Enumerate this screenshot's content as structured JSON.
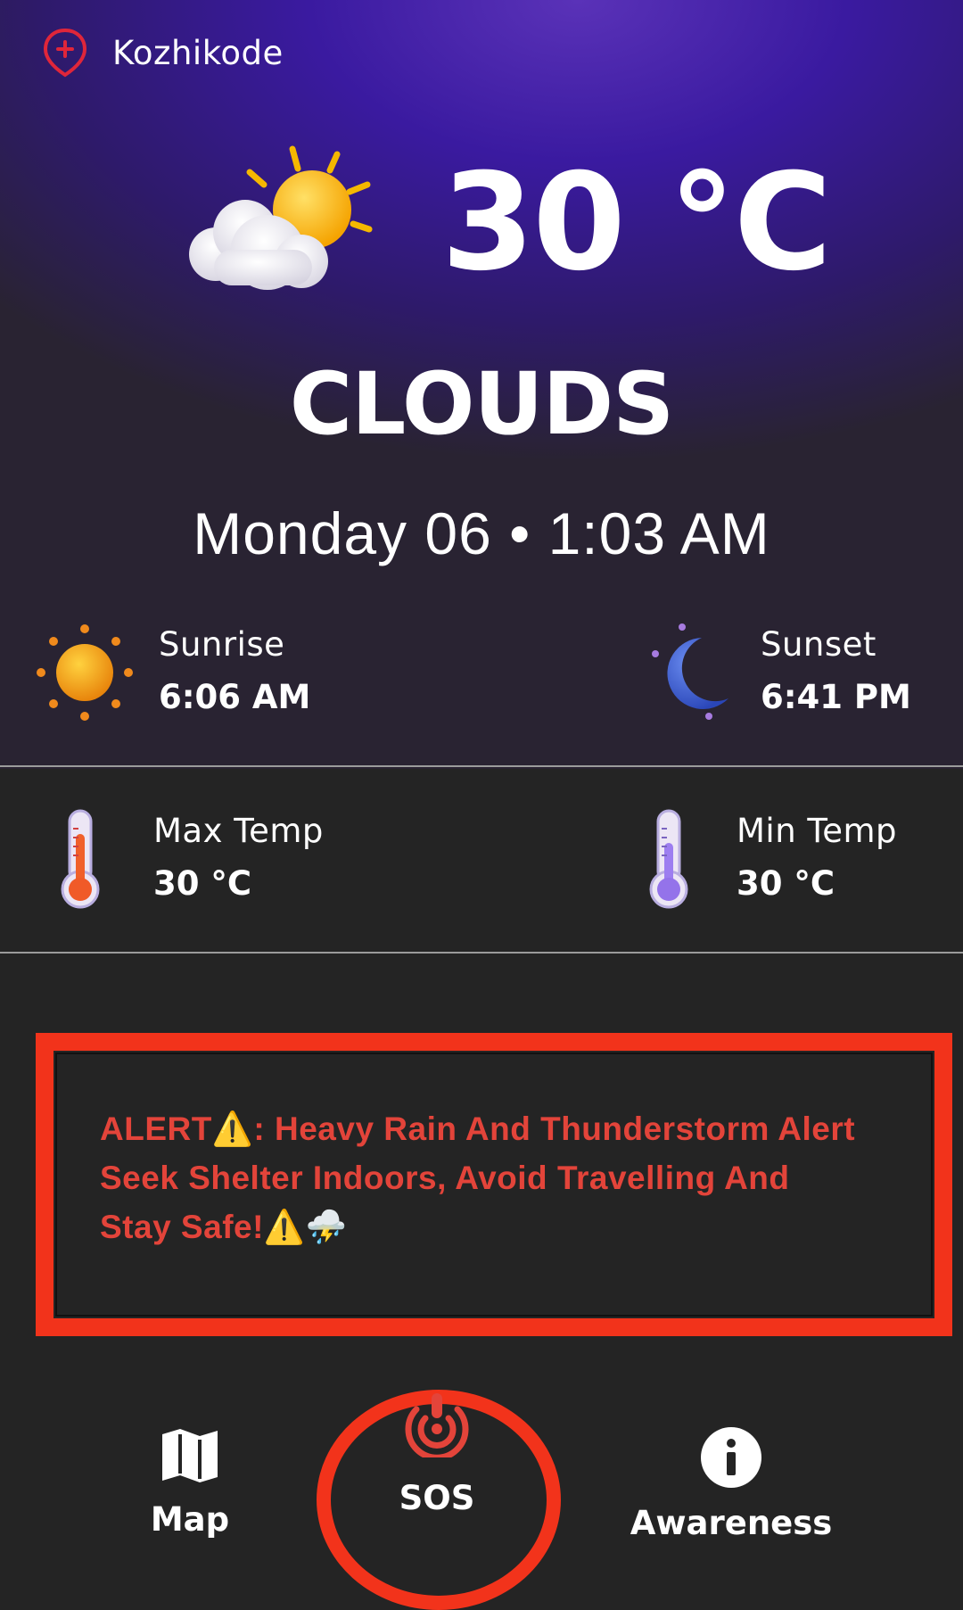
{
  "location": {
    "name": "Kozhikode"
  },
  "current": {
    "temperature": "30 °C",
    "condition": "CLOUDS",
    "datetime": "Monday 06 • 1:03 AM",
    "icon": "sun-behind-cloud-icon"
  },
  "sun": {
    "sunrise_label": "Sunrise",
    "sunrise_time": "6:06 AM",
    "sunset_label": "Sunset",
    "sunset_time": "6:41 PM"
  },
  "temps": {
    "max_label": "Max Temp",
    "max_value": "30 °C",
    "min_label": "Min Temp",
    "min_value": "30 °C"
  },
  "alert": {
    "text": "ALERT⚠️: Heavy Rain And Thunderstorm Alert  Seek Shelter Indoors, Avoid Travelling And Stay Safe!⚠️⛈️",
    "color": "#e3443a"
  },
  "nav": {
    "map_label": "Map",
    "sos_label": "SOS",
    "awareness_label": "Awareness"
  },
  "colors": {
    "highlight": "#f2331b",
    "hero_top": "#5a32b8",
    "background": "#242424"
  }
}
